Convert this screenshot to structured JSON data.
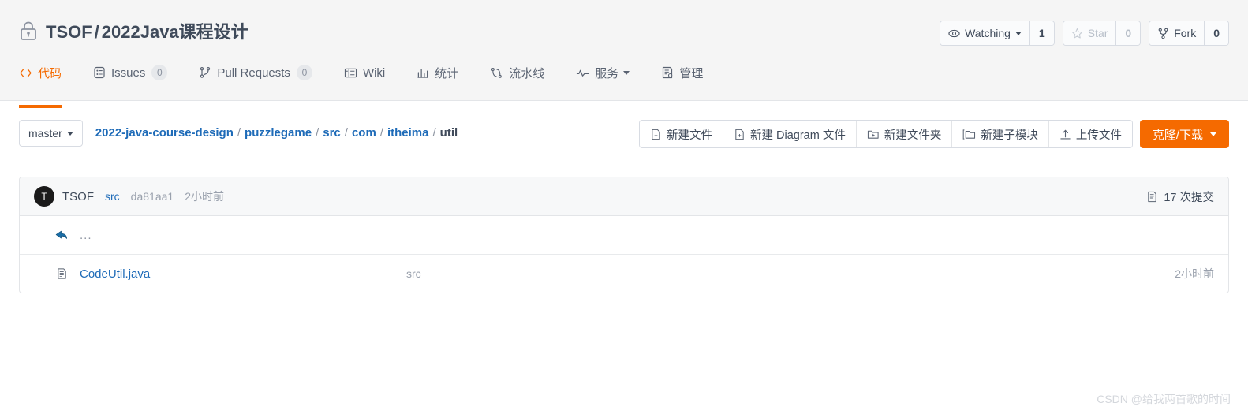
{
  "header": {
    "lock_icon": "lock-icon",
    "owner": "TSOF",
    "separator": "/",
    "repo_name": "2022Java课程设计",
    "actions": [
      {
        "icon": "eye-icon",
        "label": "Watching",
        "count": "1",
        "has_caret": true,
        "disabled": false
      },
      {
        "icon": "star-icon",
        "label": "Star",
        "count": "0",
        "has_caret": false,
        "disabled": true
      },
      {
        "icon": "fork-icon",
        "label": "Fork",
        "count": "0",
        "has_caret": false,
        "disabled": false
      }
    ]
  },
  "nav": {
    "tabs": [
      {
        "icon": "code-icon",
        "label": "代码",
        "count": null,
        "active": true,
        "caret": false
      },
      {
        "icon": "issues-icon",
        "label": "Issues",
        "count": "0",
        "active": false,
        "caret": false
      },
      {
        "icon": "pull-request-icon",
        "label": "Pull Requests",
        "count": "0",
        "active": false,
        "caret": false
      },
      {
        "icon": "wiki-icon",
        "label": "Wiki",
        "count": null,
        "active": false,
        "caret": false
      },
      {
        "icon": "chart-icon",
        "label": "统计",
        "count": null,
        "active": false,
        "caret": false
      },
      {
        "icon": "pipeline-icon",
        "label": "流水线",
        "count": null,
        "active": false,
        "caret": false
      },
      {
        "icon": "service-icon",
        "label": "服务",
        "count": null,
        "active": false,
        "caret": true
      },
      {
        "icon": "manage-icon",
        "label": "管理",
        "count": null,
        "active": false,
        "caret": false
      }
    ]
  },
  "branch": {
    "name": "master",
    "caret_icon": "chevron-down-icon"
  },
  "breadcrumb": {
    "items": [
      {
        "label": "2022-java-course-design",
        "current": false
      },
      {
        "label": "puzzlegame",
        "current": false
      },
      {
        "label": "src",
        "current": false
      },
      {
        "label": "com",
        "current": false
      },
      {
        "label": "itheima",
        "current": false
      },
      {
        "label": "util",
        "current": true
      }
    ],
    "separator": "/"
  },
  "toolbar": {
    "buttons": [
      {
        "icon": "new-file-icon",
        "label": "新建文件"
      },
      {
        "icon": "new-diagram-icon",
        "label": "新建 Diagram 文件"
      },
      {
        "icon": "new-folder-icon",
        "label": "新建文件夹"
      },
      {
        "icon": "new-submodule-icon",
        "label": "新建子模块"
      },
      {
        "icon": "upload-icon",
        "label": "上传文件"
      }
    ],
    "primary": {
      "label": "克隆/下载",
      "caret_icon": "chevron-down-icon",
      "color": "#f56a00"
    }
  },
  "commit_bar": {
    "avatar_initial": "T",
    "author": "TSOF",
    "message": "src",
    "sha": "da81aa1",
    "time": "2小时前",
    "commits_icon": "commits-icon",
    "commits_label": "17 次提交"
  },
  "files": [
    {
      "icon": "back-arrow-icon",
      "name": "...",
      "is_parent": true,
      "message": "",
      "time": ""
    },
    {
      "icon": "file-icon",
      "name": "CodeUtil.java",
      "is_parent": false,
      "message": "src",
      "time": "2小时前"
    }
  ],
  "watermark": {
    "text": "CSDN @给我两首歌的时间"
  },
  "colors": {
    "accent": "#f56a00",
    "link": "#1e6bb8",
    "text": "#3f4a5a",
    "muted": "#9aa1ad",
    "header_bg": "#f5f5f5",
    "border": "#e3e5e8"
  }
}
